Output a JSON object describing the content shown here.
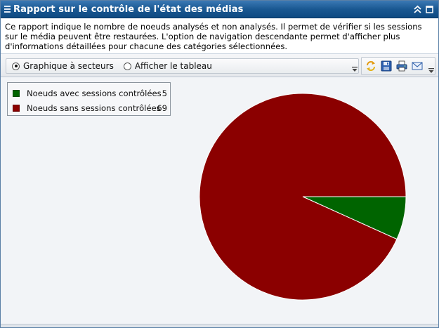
{
  "window": {
    "title": "Rapport sur le contrôle de l'état des médias"
  },
  "description": "Ce rapport indique le nombre de noeuds analysés et non analysés. Il permet de vérifier si les sessions sur le média peuvent être restaurées. L'option de navigation descendante permet d'afficher plus d'informations détaillées pour chacune des catégories sélectionnées.",
  "toolbar": {
    "view_options": [
      {
        "label": "Graphique à secteurs",
        "selected": true
      },
      {
        "label": "Afficher le tableau",
        "selected": false
      }
    ],
    "icons": [
      "refresh-icon",
      "save-icon",
      "print-icon",
      "email-icon"
    ]
  },
  "chart_data": {
    "type": "pie",
    "title": "",
    "legend": "top-left",
    "slices": [
      {
        "label": "Noeuds avec sessions contrôlées",
        "value": 5,
        "color": "#006400"
      },
      {
        "label": "Noeuds sans sessions contrôlées",
        "value": 69,
        "color": "#8b0000"
      }
    ]
  }
}
